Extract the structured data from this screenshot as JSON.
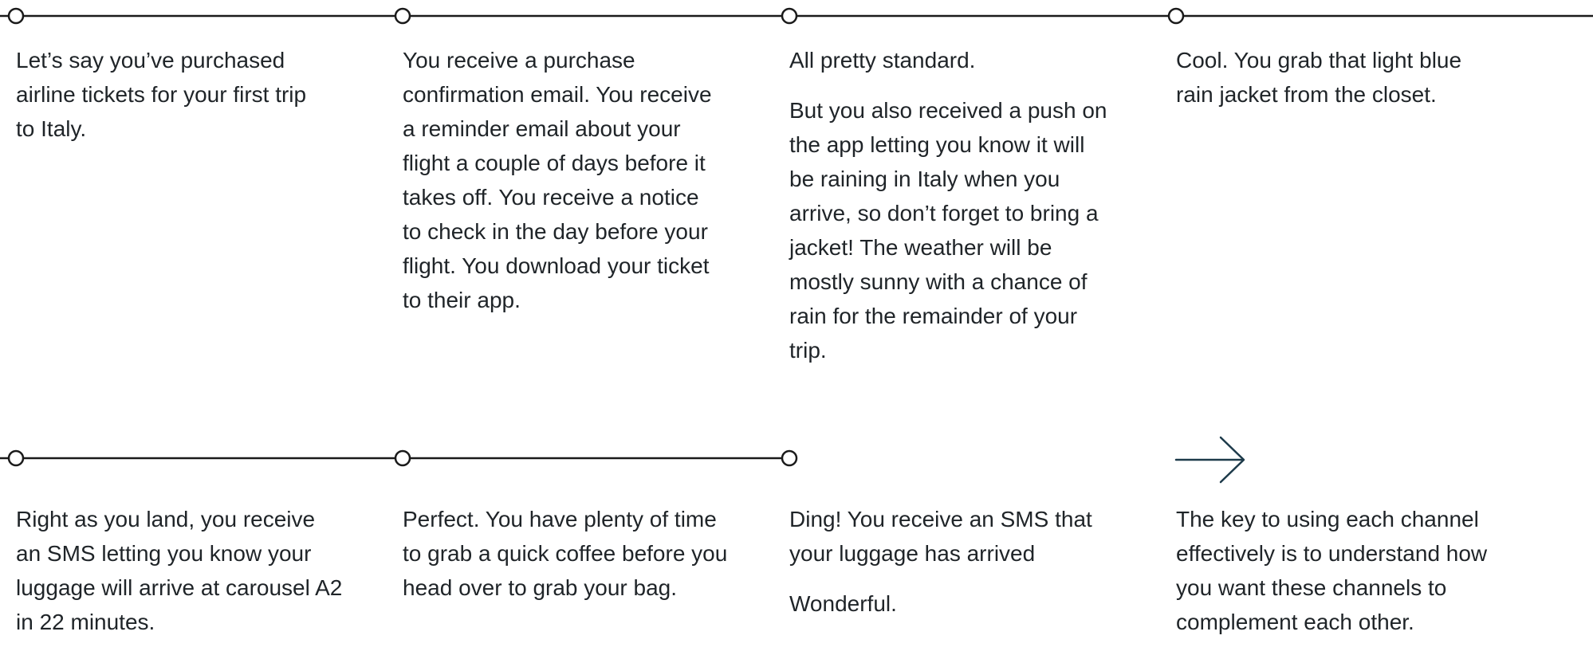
{
  "colors": {
    "line": "#1a1a1a",
    "arrow": "#1d3a4a",
    "text": "#1f2428"
  },
  "icons": {
    "timeline_node": "circle-node-icon",
    "conclusion": "arrow-right-icon"
  },
  "steps": [
    {
      "paragraphs": [
        "Let’s say you’ve purchased airline tickets for your first trip to Italy."
      ]
    },
    {
      "paragraphs": [
        "You receive a purchase confirmation email. You receive a reminder email about your flight a couple of days before it takes off. You receive a notice to check in the day before your flight. You download your ticket to their app."
      ]
    },
    {
      "paragraphs": [
        "All pretty standard.",
        "But you also received a push on the app letting you know it will be raining in Italy when you arrive, so don’t forget to bring a jacket! The weather will be mostly sunny with a chance of rain for the remainder of your trip."
      ]
    },
    {
      "paragraphs": [
        "Cool. You grab that light blue rain jacket from the closet."
      ]
    },
    {
      "paragraphs": [
        "Right as you land, you receive an SMS letting you know your luggage will arrive at carousel A2 in 22 minutes."
      ]
    },
    {
      "paragraphs": [
        "Perfect. You have plenty of time to grab a quick coffee before you head over to grab your bag."
      ]
    },
    {
      "paragraphs": [
        "Ding! You receive an SMS that your luggage has arrived",
        "Wonderful."
      ]
    },
    {
      "paragraphs": [
        "The key to using each channel effectively is to understand how you want these channels to complement each other."
      ]
    }
  ]
}
